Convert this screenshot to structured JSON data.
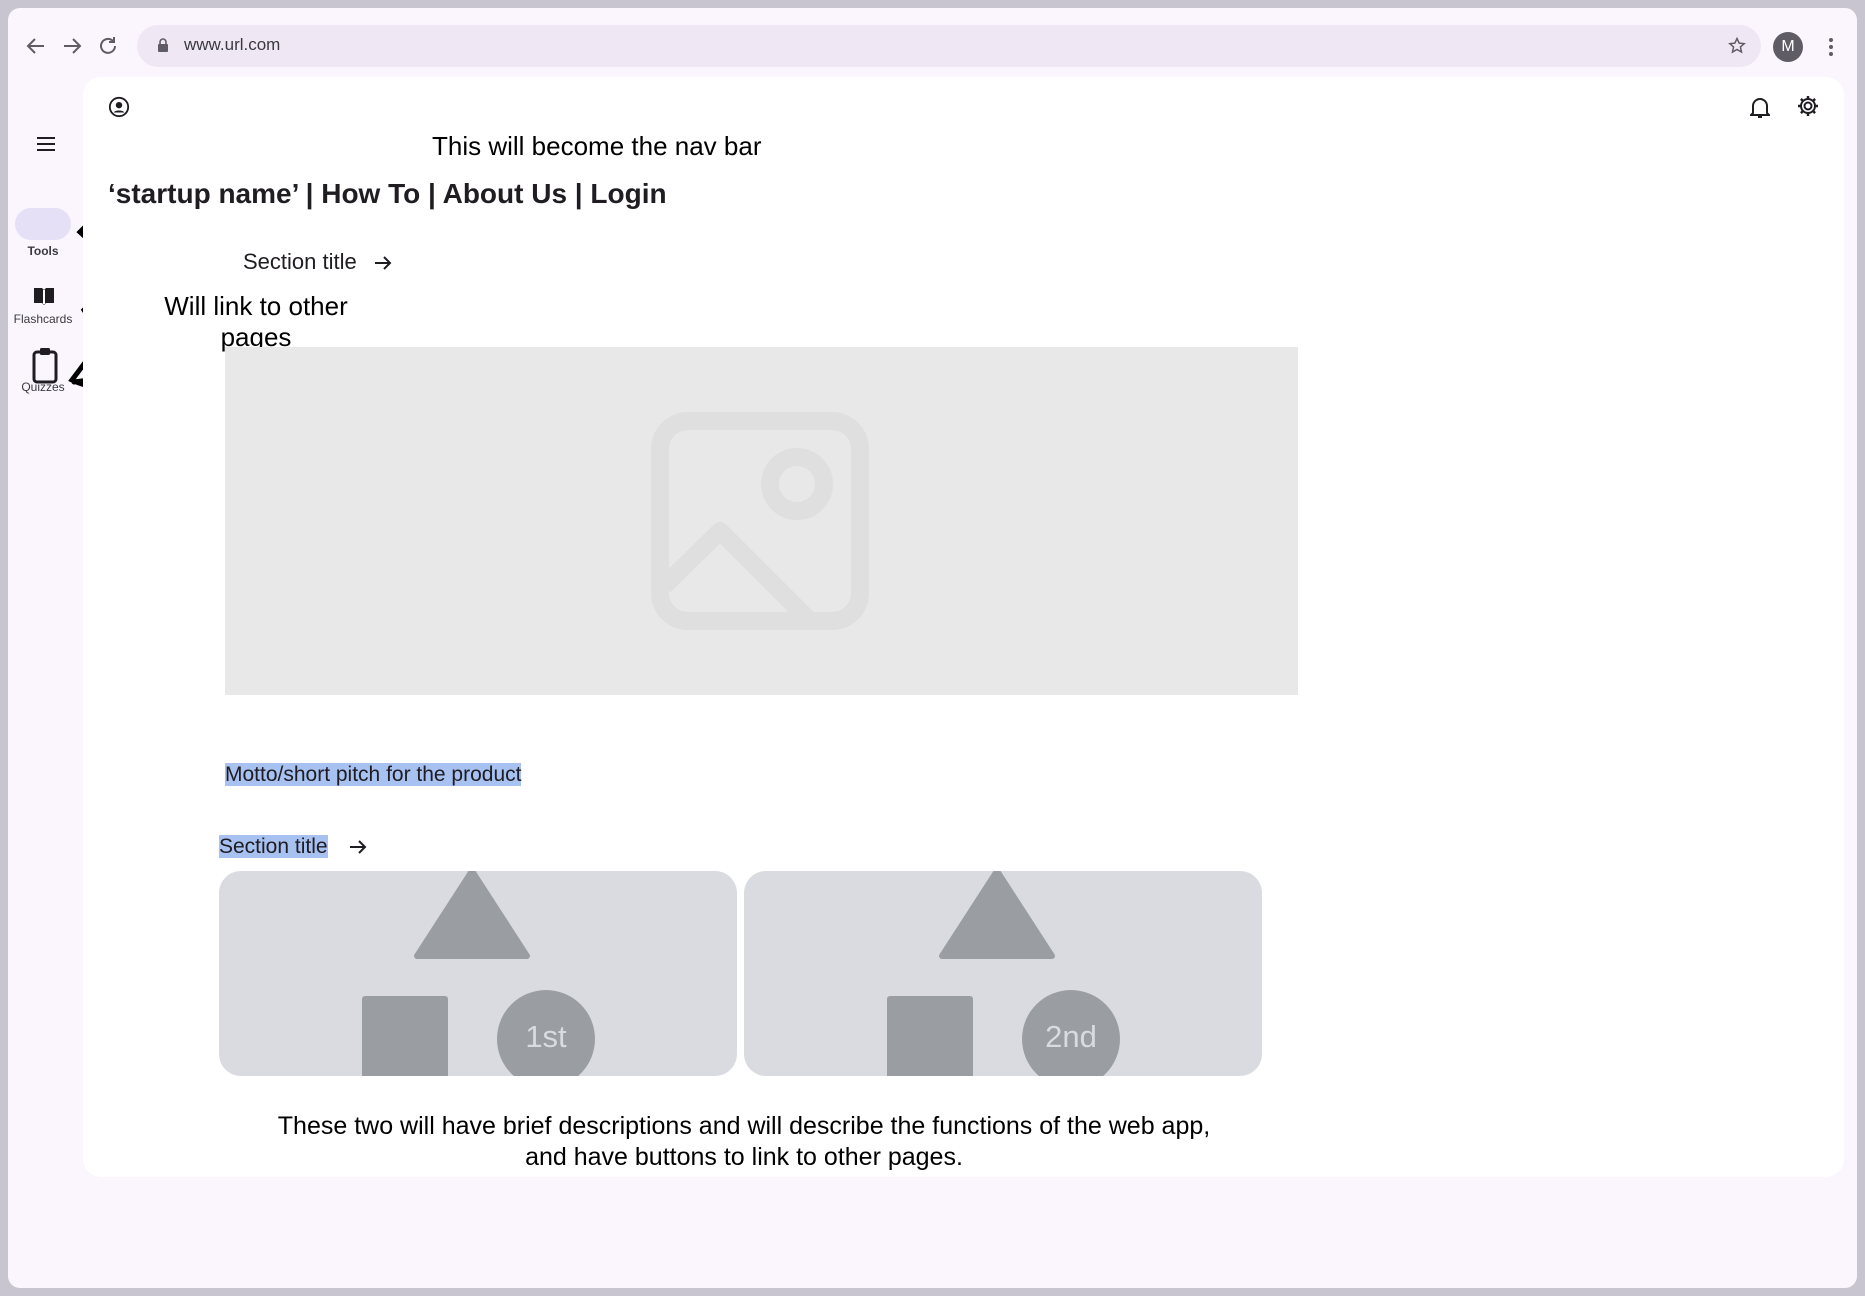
{
  "browser": {
    "url": "www.url.com",
    "profile_initial": "M"
  },
  "rail": {
    "items": [
      {
        "label": "Tools",
        "icon": "tools-pill"
      },
      {
        "label": "Flashcards",
        "icon": "book-icon"
      },
      {
        "label": "Quizzes",
        "icon": "clipboard-icon"
      }
    ]
  },
  "annotations": {
    "nav_note": "This will become the nav bar",
    "link_note_line1": "Will link to other",
    "link_note_line2": "pages",
    "bottom_note_line1": "These two will have brief descriptions and will describe the functions of the web app,",
    "bottom_note_line2": "and have buttons to link to other pages."
  },
  "nav": {
    "text": "‘startup name’ | How To | About Us | Login"
  },
  "main": {
    "section1_title": "Section title",
    "motto": "Motto/short pitch for the product",
    "section2_title": "Section title",
    "tiles": [
      {
        "badge": "1st"
      },
      {
        "badge": "2nd"
      }
    ]
  },
  "colors": {
    "page": "#fbf6fd",
    "card": "#ffffff",
    "hero": "#e8e8e8",
    "tile": "#dadbe0",
    "shape": "#9a9ea2",
    "highlight": "#a7c1f0",
    "tools_pill": "#e6e0f6"
  }
}
